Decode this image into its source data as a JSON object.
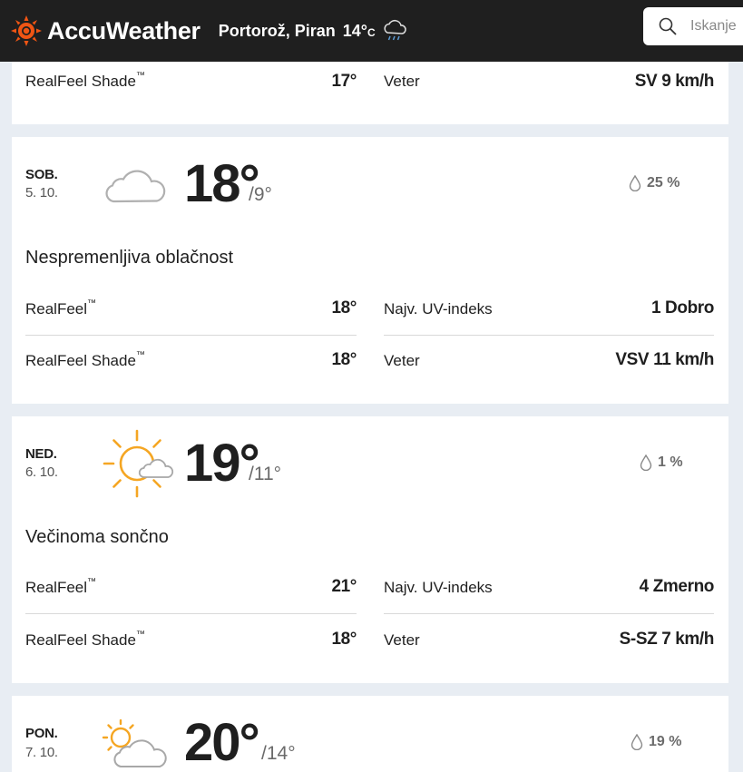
{
  "header": {
    "brand": "AccuWeather",
    "location": "Portorož, Piran",
    "temp": "14°",
    "unit": "C",
    "search_placeholder": "Iskanje"
  },
  "top_card": {
    "realfeel_shade_label": "RealFeel Shade",
    "realfeel_shade_value": "17°",
    "wind_label": "Veter",
    "wind_value": "SV 9 km/h"
  },
  "days": [
    {
      "day": "SOB.",
      "date": "5. 10.",
      "icon": "cloud-icon",
      "high": "18°",
      "low": "/9°",
      "precip": "25 %",
      "phrase": "Nespremenljiva oblačnost",
      "realfeel_label": "RealFeel",
      "realfeel": "18°",
      "uv_label": "Najv. UV-indeks",
      "uv": "1 Dobro",
      "shade_label": "RealFeel Shade",
      "shade": "18°",
      "wind_label": "Veter",
      "wind": "VSV 11 km/h"
    },
    {
      "day": "NED.",
      "date": "6. 10.",
      "icon": "mostly-sunny-icon",
      "high": "19°",
      "low": "/11°",
      "precip": "1 %",
      "phrase": "Večinoma sončno",
      "realfeel_label": "RealFeel",
      "realfeel": "21°",
      "uv_label": "Najv. UV-indeks",
      "uv": "4 Zmerno",
      "shade_label": "RealFeel Shade",
      "shade": "18°",
      "wind_label": "Veter",
      "wind": "S-SZ 7 km/h"
    },
    {
      "day": "PON.",
      "date": "7. 10.",
      "icon": "partly-sunny-icon",
      "high": "20°",
      "low": "/14°",
      "precip": "19 %"
    }
  ],
  "colors": {
    "header_bg": "#1f1f1f",
    "brand_orange": "#f05514",
    "sun_orange": "#f5a623",
    "page_bg": "#e8edf3"
  }
}
